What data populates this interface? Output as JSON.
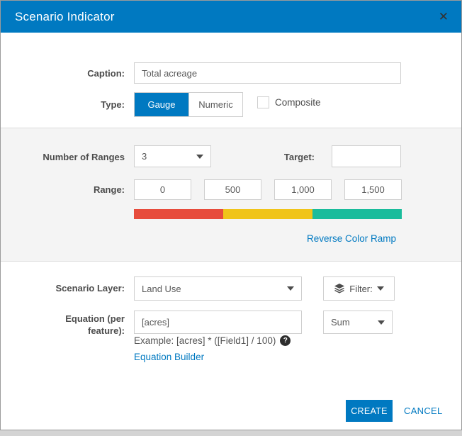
{
  "colors": {
    "accent": "#0079c1",
    "ramp": [
      "#e74c3c",
      "#f0c419",
      "#1abc9c"
    ]
  },
  "icons": {
    "close": "✕",
    "help": "?"
  },
  "header": {
    "title": "Scenario Indicator"
  },
  "form": {
    "caption": {
      "label": "Caption:",
      "value": "Total acreage"
    },
    "type": {
      "label": "Type:",
      "options": [
        "Gauge",
        "Numeric"
      ],
      "selected": "Gauge",
      "composite": {
        "label": "Composite",
        "checked": false
      }
    },
    "ranges": {
      "number_of_ranges": {
        "label": "Number of Ranges",
        "value": "3"
      },
      "target": {
        "label": "Target:",
        "value": ""
      },
      "range": {
        "label": "Range:",
        "values": [
          "0",
          "500",
          "1,000",
          "1,500"
        ]
      },
      "reverse_link": "Reverse Color Ramp"
    },
    "scenario_layer": {
      "label": "Scenario Layer:",
      "value": "Land Use",
      "filter": {
        "label": "Filter:"
      }
    },
    "equation": {
      "label": "Equation (per feature):",
      "value": "[acres]",
      "example": "Example: [acres] * ([Field1] / 100)",
      "builder_link": "Equation Builder",
      "aggregation": {
        "value": "Sum"
      }
    }
  },
  "footer": {
    "create_label": "CREATE",
    "cancel_label": "CANCEL"
  }
}
